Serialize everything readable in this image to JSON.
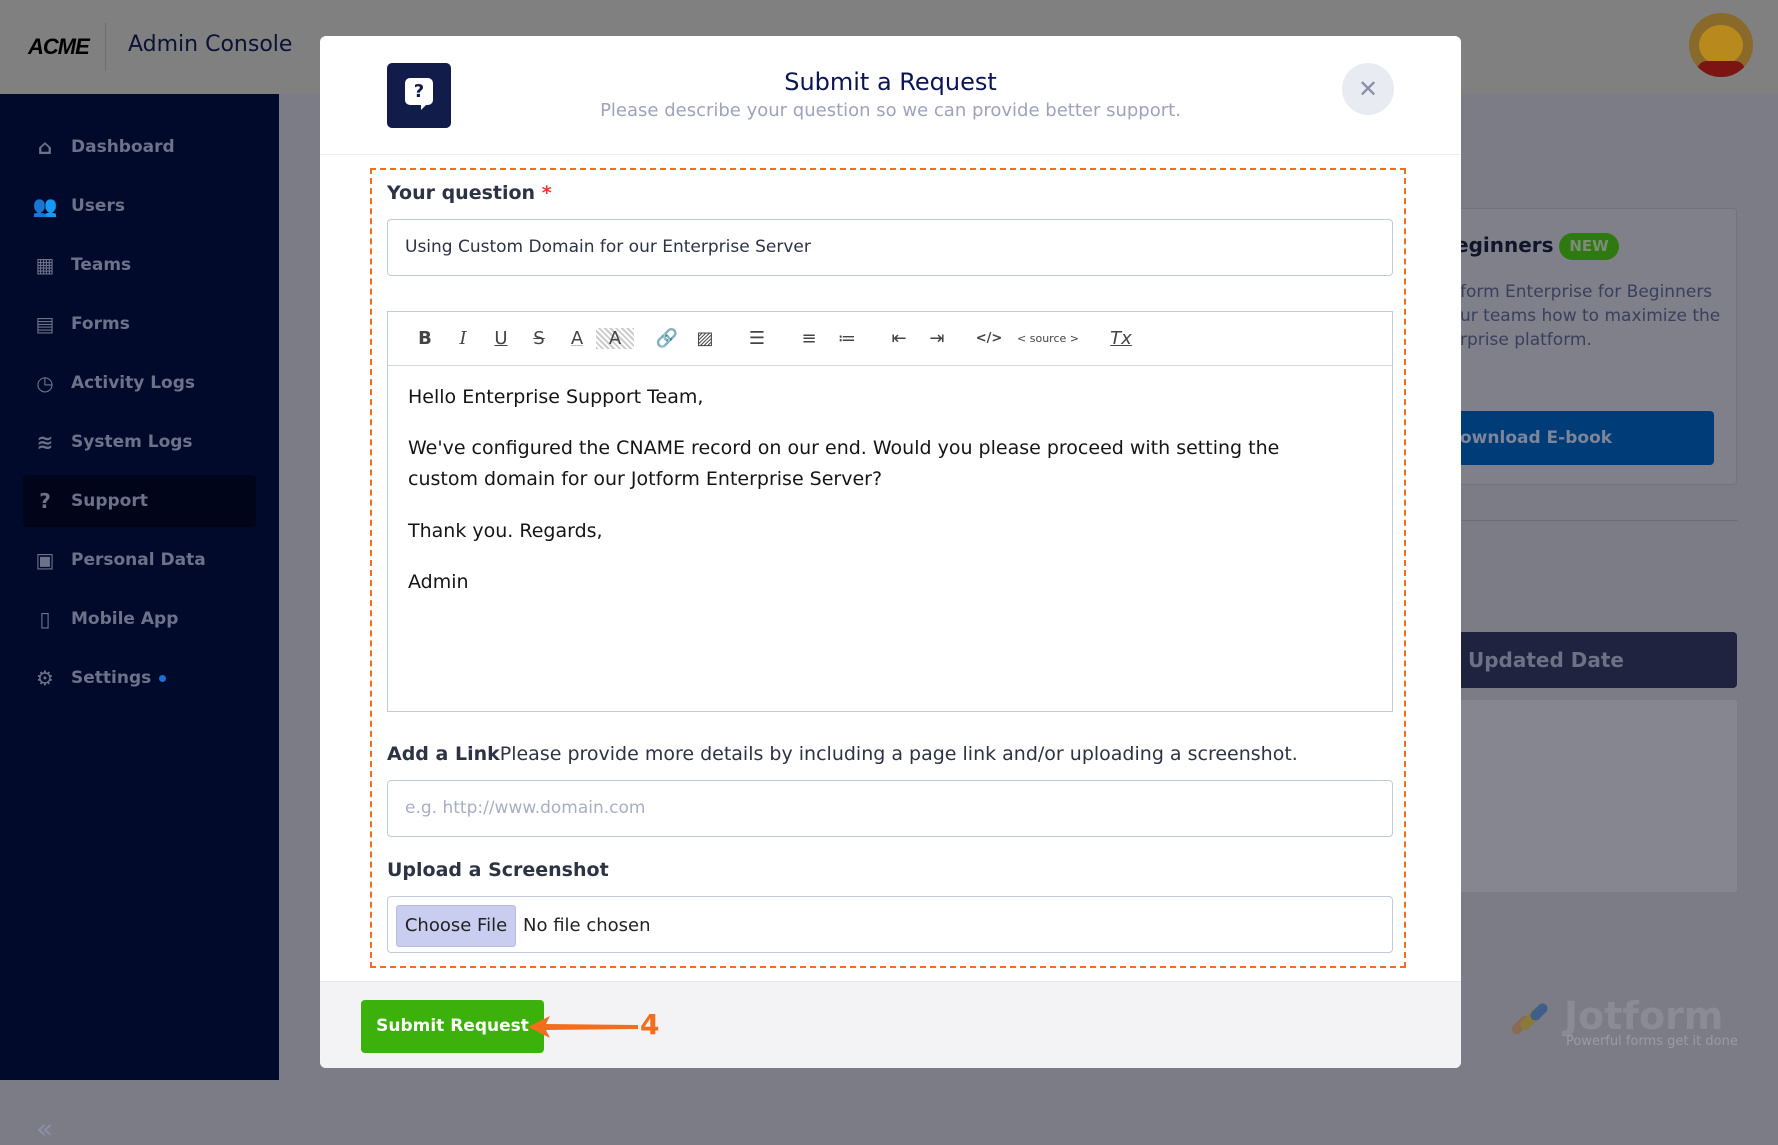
{
  "header": {
    "logo": "ACME",
    "title": "Admin Console"
  },
  "sidebar": {
    "items": [
      {
        "label": "Dashboard",
        "icon": "home-icon",
        "glyph": "⌂"
      },
      {
        "label": "Users",
        "icon": "users-icon",
        "glyph": "👥"
      },
      {
        "label": "Teams",
        "icon": "teams-icon",
        "glyph": "▦"
      },
      {
        "label": "Forms",
        "icon": "forms-icon",
        "glyph": "▤"
      },
      {
        "label": "Activity Logs",
        "icon": "clock-icon",
        "glyph": "◷"
      },
      {
        "label": "System Logs",
        "icon": "database-icon",
        "glyph": "≋"
      },
      {
        "label": "Support",
        "icon": "support-icon",
        "glyph": "?",
        "active": true
      },
      {
        "label": "Personal Data",
        "icon": "personal-data-icon",
        "glyph": "▣"
      },
      {
        "label": "Mobile App",
        "icon": "mobile-icon",
        "glyph": "▯"
      },
      {
        "label": "Settings",
        "icon": "gear-icon",
        "glyph": "⚙"
      }
    ],
    "collapse": "«"
  },
  "background": {
    "card_title": "eginners",
    "badge": "NEW",
    "card_lines": [
      "form Enterprise for Beginners",
      "ur teams how to maximize the",
      "rprise platform."
    ],
    "download": "ownload E-book",
    "updated": "Updated Date"
  },
  "brand": {
    "name": "Jotform",
    "tagline": "Powerful forms get it done"
  },
  "modal": {
    "title": "Submit a Request",
    "subtitle": "Please describe your question so we can provide better support.",
    "close": "✕",
    "question_label": "Your question",
    "required": "*",
    "question_value": "Using Custom Domain for our Enterprise Server",
    "toolbar": {
      "bold": "B",
      "italic": "I",
      "underline": "U",
      "strike": "S",
      "font_color": "A",
      "bg_color": "A",
      "link": "🔗",
      "image": "▨",
      "align": "☰",
      "ordered_list": "≡",
      "bullet_list": "≔",
      "outdent": "⇤",
      "indent": "⇥",
      "code": "</>",
      "source": "< source >",
      "clear": "Tx"
    },
    "body": [
      "Hello Enterprise Support Team,",
      "We've configured the CNAME record on our end. Would you please proceed with setting the",
      "custom domain for our Jotform Enterprise Server?",
      "Thank you. Regards,",
      "Admin"
    ],
    "link_label": "Add a Link",
    "link_help": "Please provide more details by including a page link and/or uploading a screenshot.",
    "link_placeholder": "e.g. http://www.domain.com",
    "upload_label": "Upload a Screenshot",
    "choose_file": "Choose File",
    "no_file": "No file chosen",
    "submit": "Submit Request",
    "step": "4"
  },
  "colors": {
    "accent": "#3cb00b",
    "annotation": "#f36e1c",
    "navy": "#0a1551"
  }
}
